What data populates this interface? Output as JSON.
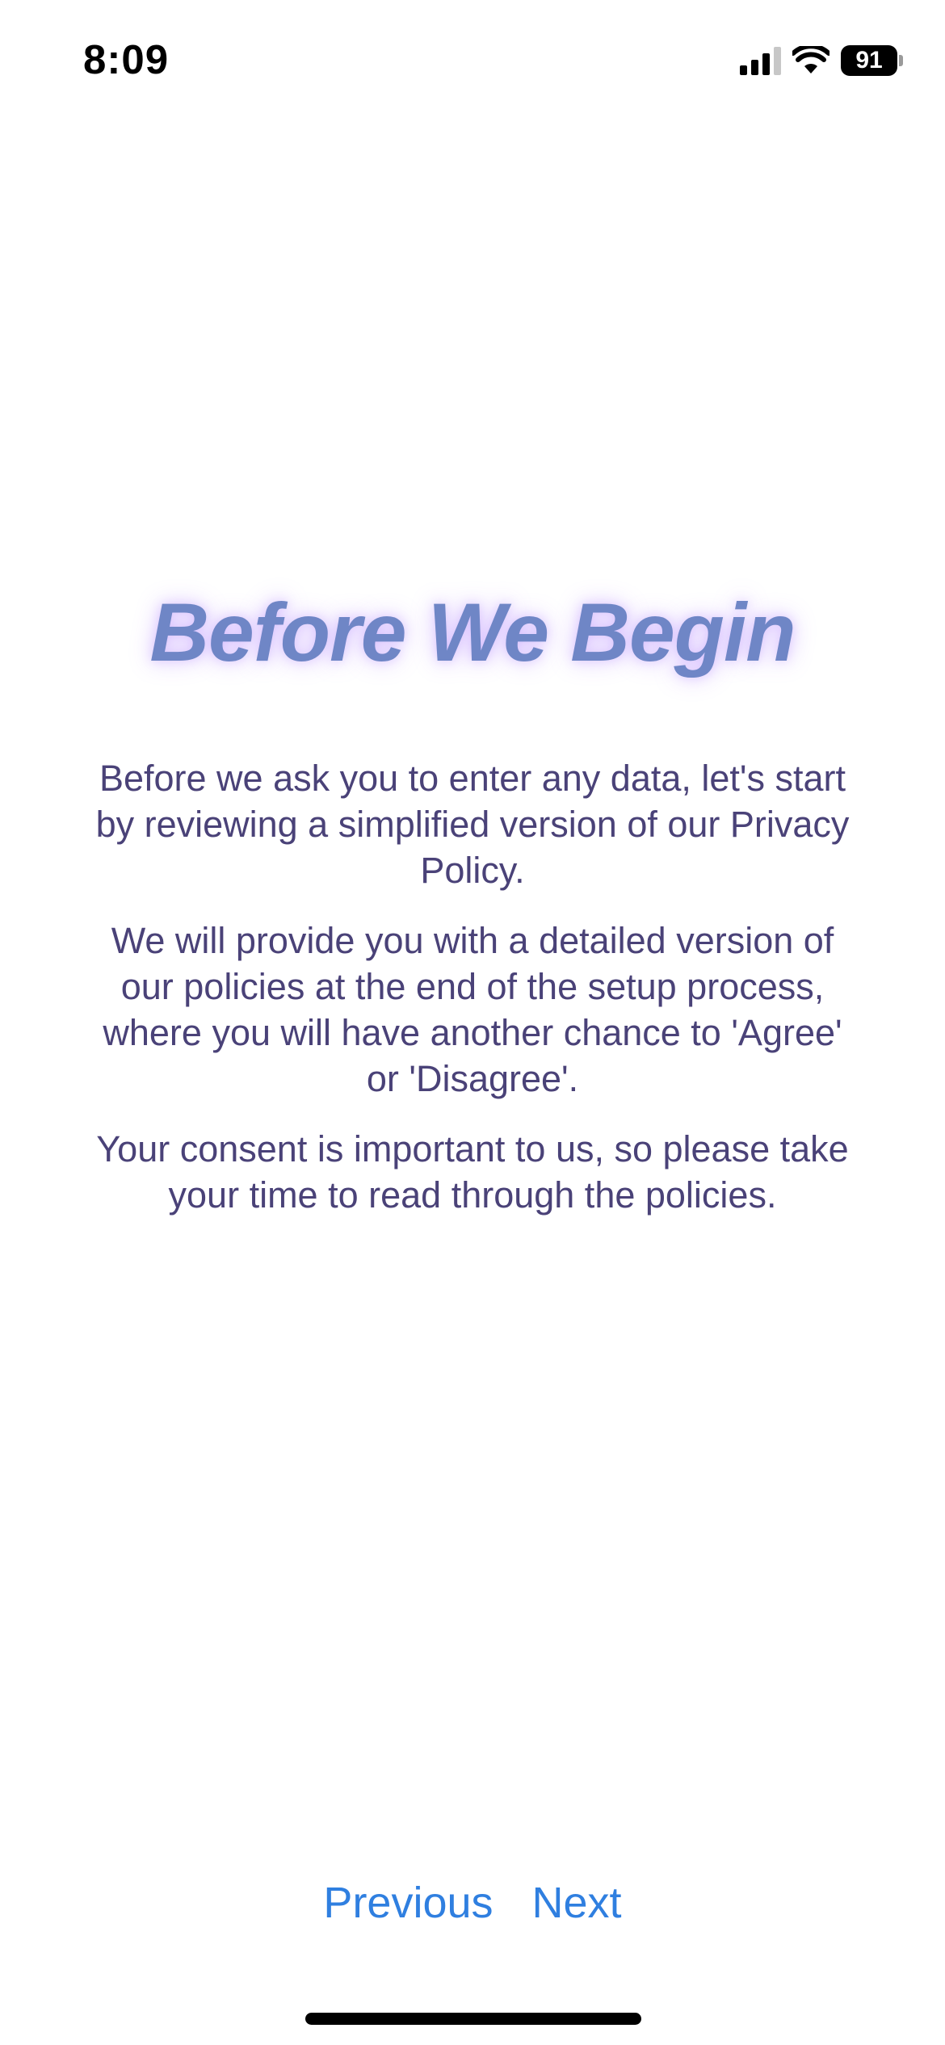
{
  "status_bar": {
    "time": "8:09",
    "battery_level": "91",
    "icons": [
      "cellular-signal-icon",
      "wifi-icon",
      "battery-icon"
    ]
  },
  "page": {
    "title": "Before We Begin",
    "paragraphs": [
      "Before we ask you to enter any data, let's start by reviewing a simplified version of our Privacy Policy.",
      "We will provide you with a detailed version of our policies at the end of the setup process, where you will have another chance to 'Agree' or 'Disagree'.",
      "Your consent is important to us, so please take your time to read through the policies."
    ]
  },
  "navigation": {
    "previous_label": "Previous",
    "next_label": "Next"
  },
  "colors": {
    "title": "#6f86c6",
    "title_glow": "#aa78ff",
    "body_text": "#4a4278",
    "link": "#2f7fe0",
    "background": "#ffffff"
  }
}
